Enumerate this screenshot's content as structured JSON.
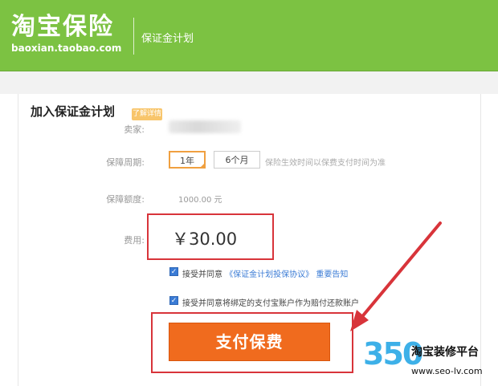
{
  "header": {
    "logo": "淘宝保险",
    "logo_sub": "baoxian.taobao.com",
    "title": "保证金计划"
  },
  "form": {
    "section_title": "加入保证金计划",
    "hint_tag": "了解详情",
    "seller_label": "卖家:",
    "period_label": "保障周期:",
    "period_options": [
      "1年",
      "6个月"
    ],
    "period_selected": "1年",
    "period_note": "保险生效时间以保费支付时间为准",
    "amount_label": "保障额度:",
    "amount_value": "1000.00 元",
    "fee_label": "费用:",
    "fee_value": "￥30.00",
    "agree1_prefix": "接受并同意",
    "agree1_link": "《保证金计划投保协议》",
    "agree1_notice": "重要告知",
    "agree2_text": "接受并同意将绑定的支付宝账户作为赔付还款账户",
    "pay_button": "支付保费"
  },
  "watermark": {
    "number": "350",
    "title": "淘宝装修平台",
    "url": "www.seo-lv.com"
  },
  "colors": {
    "header_green": "#7cc242",
    "highlight_red": "#d8343a",
    "pay_orange": "#f06b1e",
    "link_blue": "#3a7bd5",
    "active_border": "#f0a040"
  }
}
